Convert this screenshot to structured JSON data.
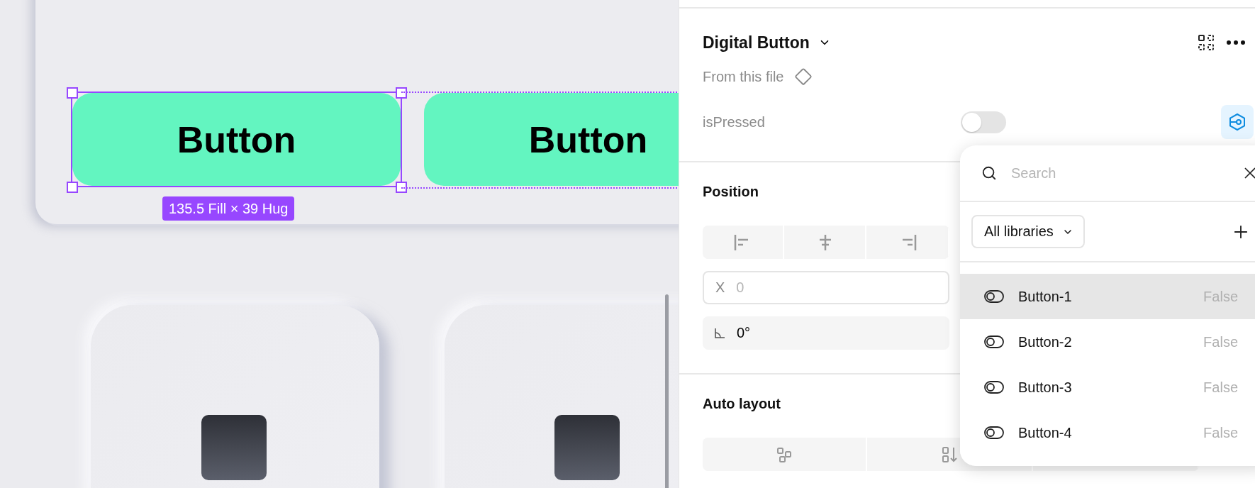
{
  "canvas": {
    "buttons": [
      {
        "label": "Button",
        "selected": true
      },
      {
        "label": "Button",
        "selected": false
      }
    ],
    "size_label": "135.5 Fill × 39 Hug"
  },
  "panel": {
    "component": {
      "title": "Digital Button",
      "source": "From this file"
    },
    "properties": [
      {
        "name": "isPressed",
        "on": false
      }
    ],
    "position": {
      "title": "Position",
      "x": {
        "label": "X",
        "placeholder": "0"
      },
      "rotation": {
        "value": "0°"
      }
    },
    "auto_layout": {
      "title": "Auto layout"
    }
  },
  "property_picker": {
    "search": {
      "placeholder": "Search"
    },
    "library": "All libraries",
    "items": [
      {
        "name": "Button-1",
        "value": "False",
        "selected": true
      },
      {
        "name": "Button-2",
        "value": "False",
        "selected": false
      },
      {
        "name": "Button-3",
        "value": "False",
        "selected": false
      },
      {
        "name": "Button-4",
        "value": "False",
        "selected": false
      }
    ]
  }
}
